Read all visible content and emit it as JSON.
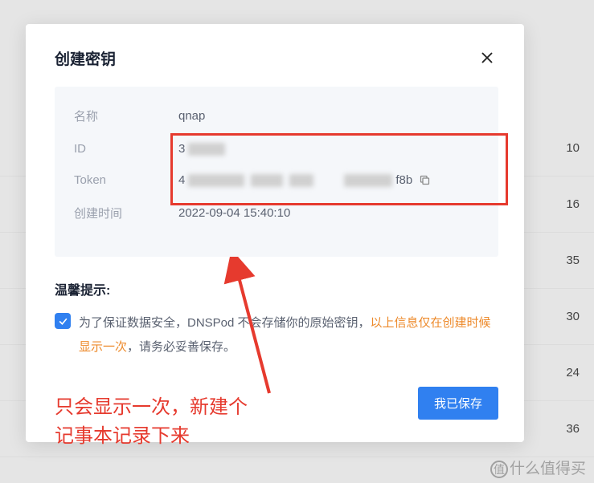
{
  "modal": {
    "title": "创建密钥",
    "info": {
      "name_label": "名称",
      "name_value": "qnap",
      "id_label": "ID",
      "id_value_prefix": "3",
      "token_label": "Token",
      "token_value_prefix": "4",
      "token_value_suffix": "f8b",
      "created_label": "创建时间",
      "created_value": "2022-09-04 15:40:10"
    },
    "hint": {
      "title": "温馨提示:",
      "text_1": "为了保证数据安全，DNSPod 不会存储你的原始密钥，",
      "text_highlight": "以上信息仅在创建时候显示一次",
      "text_2": "，请务必妥善保存。"
    },
    "save_button": "我已保存"
  },
  "annotation": {
    "line1": "只会显示一次，新建个",
    "line2": "记事本记录下来"
  },
  "bg_rows": [
    "10",
    "16",
    "35",
    "30",
    "24",
    "36"
  ],
  "watermark": "什么值得买"
}
